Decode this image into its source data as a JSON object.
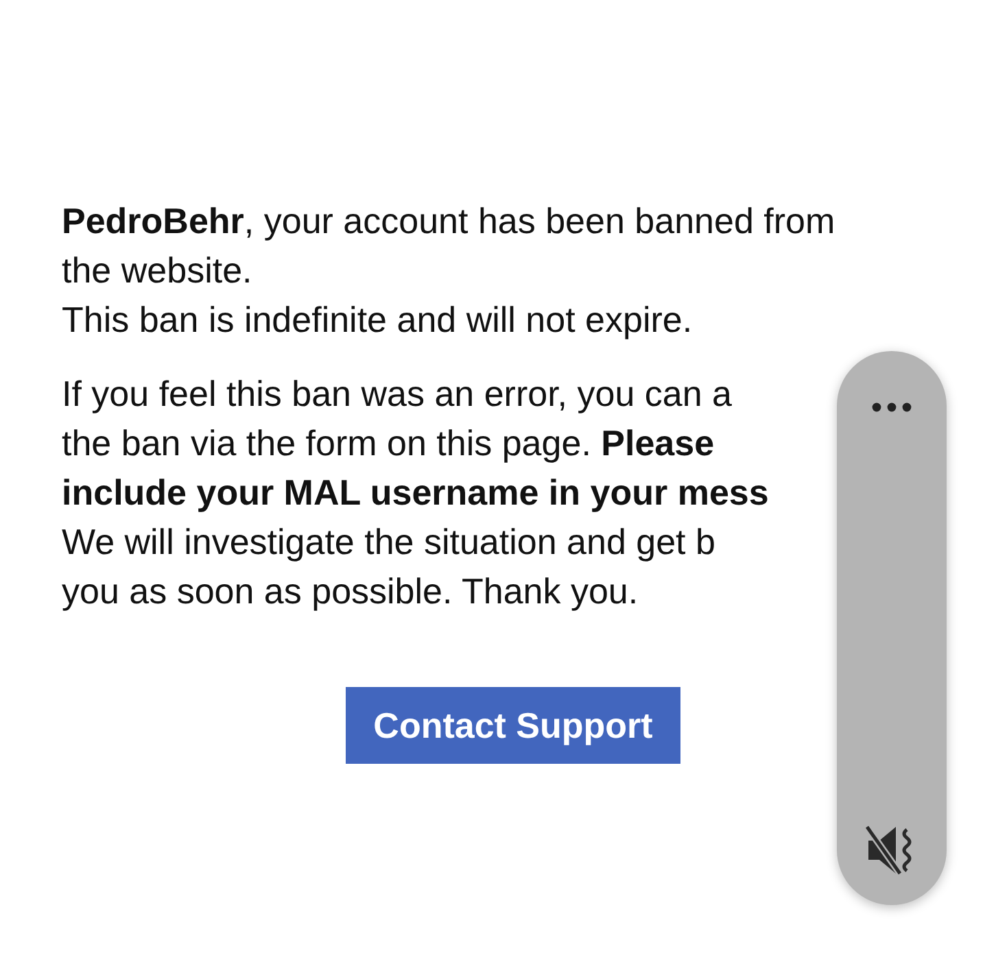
{
  "message": {
    "paragraphs": [
      {
        "lines": [
          "**PedroBehr**, your account has been banned from",
          "the website.",
          "This ban is indefinite and will not expire."
        ]
      },
      {
        "lines": [
          "If you feel this ban was an error, you can a",
          "the ban via the form on this page. **Please**",
          "**include your MAL username in your mess**",
          "We will investigate the situation and get b",
          "you as soon as possible. Thank you."
        ]
      }
    ]
  },
  "button": {
    "label": "Contact Support"
  },
  "volume_panel": {
    "muted": true
  }
}
